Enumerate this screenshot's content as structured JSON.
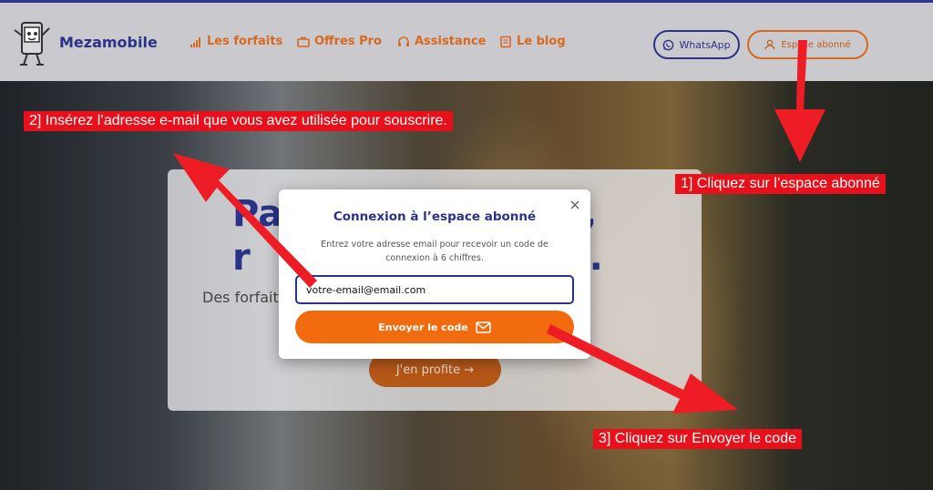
{
  "header": {
    "brand": "Mezamobile",
    "nav": [
      {
        "label": "Les forfaits",
        "icon": "signal-bars-icon"
      },
      {
        "label": "Offres Pro",
        "icon": "briefcase-icon"
      },
      {
        "label": "Assistance",
        "icon": "headset-icon"
      },
      {
        "label": "Le blog",
        "icon": "newspaper-icon"
      }
    ],
    "whatsapp_label": "WhatsApp",
    "account_label": "Espace abonné"
  },
  "hero": {
    "title": "Pa                    os,\nr                         s.",
    "subtitle": "Des forfaits                                      our rester",
    "cta_label": "J'en profite →"
  },
  "modal": {
    "title": "Connexion à l’espace abonné",
    "description": "Entrez votre adresse email pour recevoir un code de connexion à 6 chiffres.",
    "email_value": "votre-email@email.com",
    "submit_label": "Envoyer le code"
  },
  "annotations": {
    "step1": "1] Cliquez sur l’espace abonné",
    "step2": "2] Insérez l’adresse e-mail que vous avez utilisée pour souscrire.",
    "step3": "3] Cliquez sur Envoyer le code"
  },
  "colors": {
    "brand_blue": "#2b3388",
    "brand_orange": "#f26b0f",
    "annotation_red": "#e8101a"
  }
}
